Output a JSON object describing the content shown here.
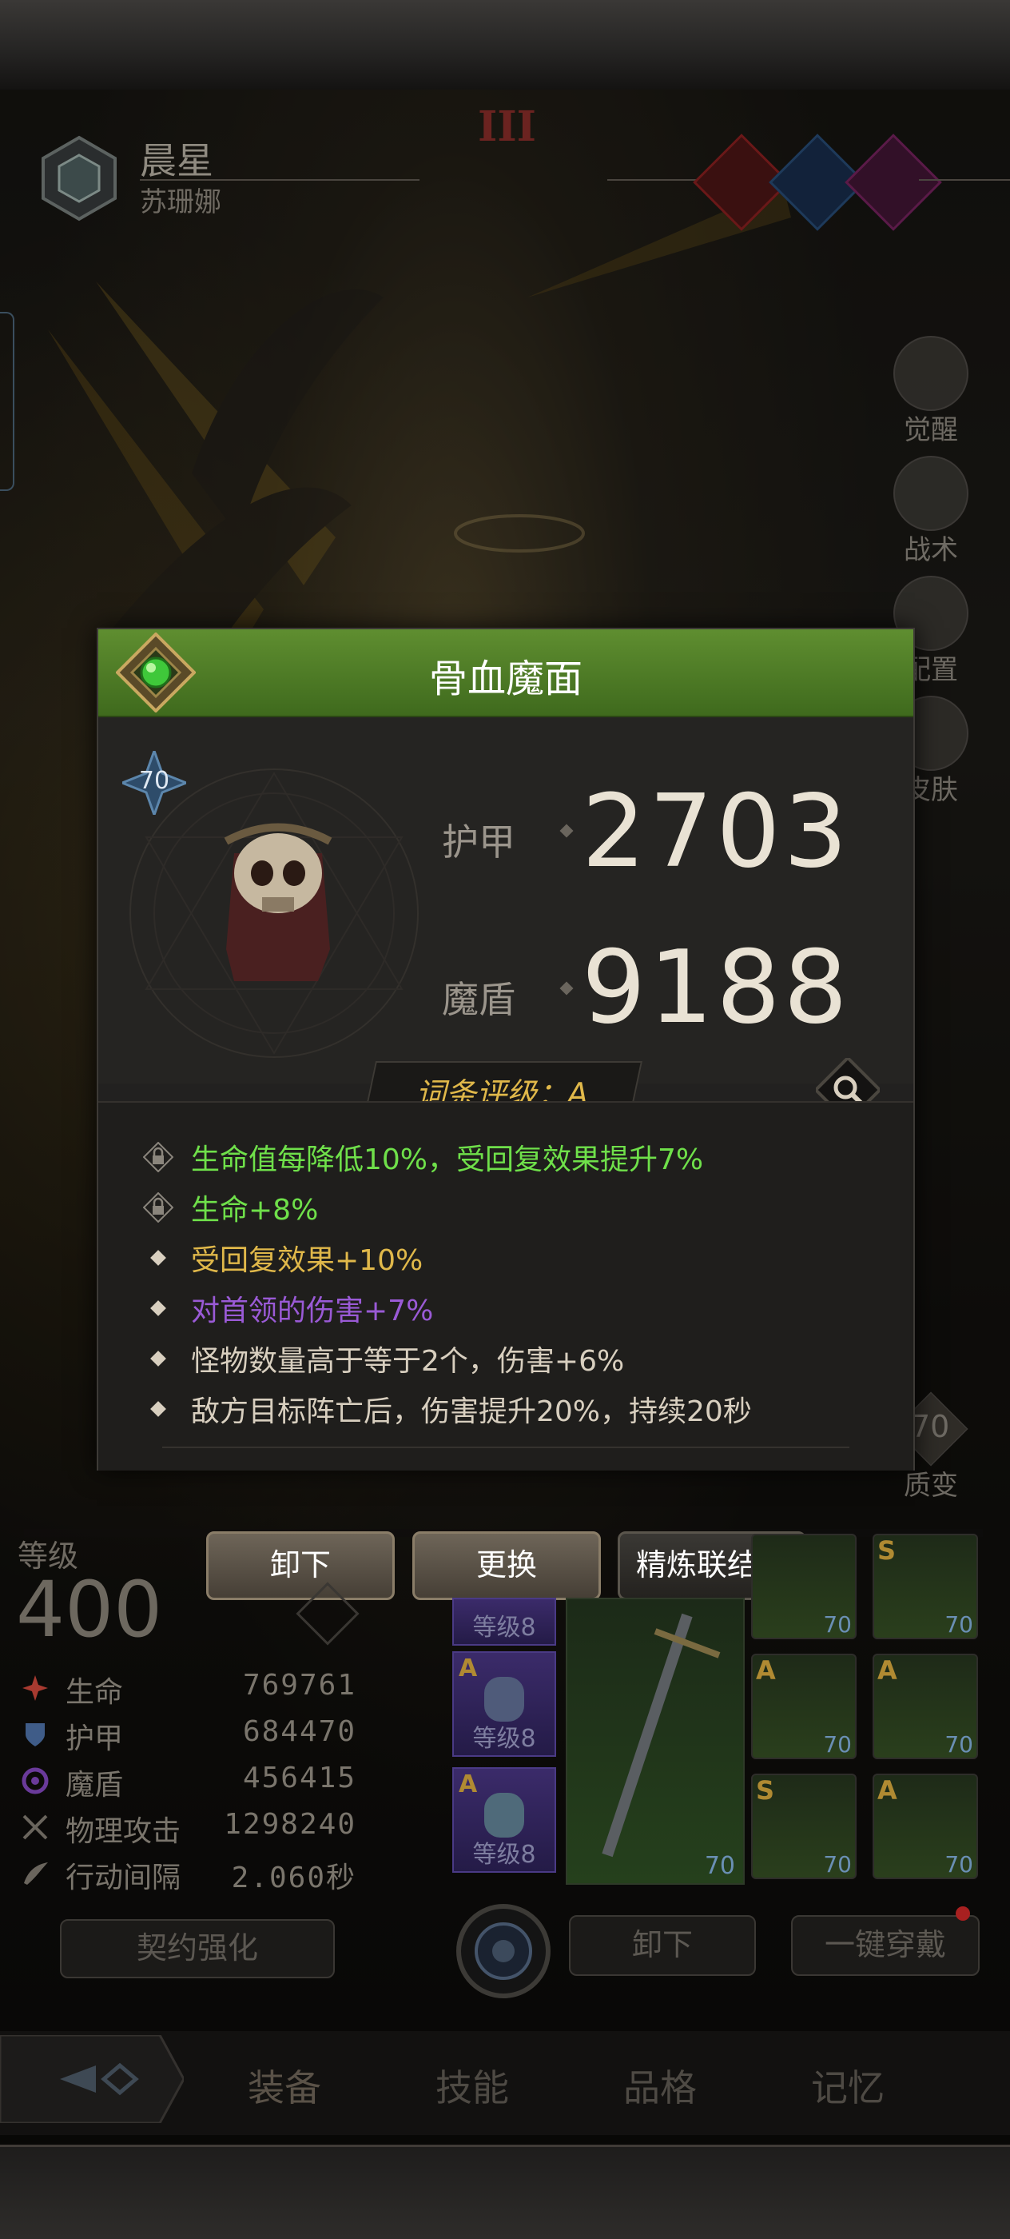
{
  "header": {
    "title": "晨星",
    "subtitle": "苏珊娜",
    "tier": "III",
    "gem_colors": [
      "#7a1f1f",
      "#1e3f63",
      "#5a1f4a"
    ]
  },
  "side_menu": [
    {
      "label": "觉醒",
      "icon": "sun-icon"
    },
    {
      "label": "战术",
      "icon": "tower-icon"
    },
    {
      "label": "配置",
      "icon": "helmet-icon"
    },
    {
      "label": "皮肤",
      "icon": "armor-icon"
    },
    {
      "label": "质变",
      "icon": "transmute-icon"
    }
  ],
  "side_menu_side_level": "70",
  "popup": {
    "title": "骨血魔面",
    "item_level": "70",
    "stats": [
      {
        "label": "护甲",
        "value": "2703"
      },
      {
        "label": "魔盾",
        "value": "9188"
      }
    ],
    "rating": "词条评级：A",
    "affixes": [
      {
        "text": "生命值每降低10%，受回复效果提升7%",
        "color": "#6fe04a",
        "locked": true
      },
      {
        "text": "生命+8%",
        "color": "#6fe04a",
        "locked": true
      },
      {
        "text": "受回复效果+10%",
        "color": "#e0b84a",
        "locked": false
      },
      {
        "text": "对首领的伤害+7%",
        "color": "#9a5ad6",
        "locked": false
      },
      {
        "text": "怪物数量高于等于2个，伤害+6%",
        "color": "#d8cfbf",
        "locked": false
      },
      {
        "text": "敌方目标阵亡后，伤害提升20%，持续20秒",
        "color": "#d8cfbf",
        "locked": false
      }
    ]
  },
  "actions": {
    "unequip": "卸下",
    "replace": "更换",
    "refine": "精炼联结中"
  },
  "character": {
    "level_label": "等级",
    "level": "400",
    "stats": [
      {
        "label": "生命",
        "value": "769761",
        "icon": "life-icon",
        "color": "#a83a30"
      },
      {
        "label": "护甲",
        "value": "684470",
        "icon": "shield-icon",
        "color": "#4a6a9a"
      },
      {
        "label": "魔盾",
        "value": "456415",
        "icon": "swirl-icon",
        "color": "#6a3a9a"
      },
      {
        "label": "物理攻击",
        "value": "1298240",
        "icon": "swords-icon",
        "color": "#7a756c"
      },
      {
        "label": "行动间隔",
        "value": "2.060秒",
        "icon": "wing-icon",
        "color": "#7a756c"
      }
    ],
    "contract_button": "契约强化"
  },
  "gems": [
    {
      "grade": "A",
      "level": "等级8"
    },
    {
      "grade": "A",
      "level": "等级8"
    },
    {
      "grade": "A",
      "level": "等级8"
    }
  ],
  "weapon_level": "70",
  "equipment_slots": [
    {
      "grade": "",
      "level": "70"
    },
    {
      "grade": "S",
      "level": "70"
    },
    {
      "grade": "A",
      "level": "70"
    },
    {
      "grade": "A",
      "level": "70"
    },
    {
      "grade": "S",
      "level": "70"
    },
    {
      "grade": "A",
      "level": "70"
    }
  ],
  "bottom_buttons": {
    "unequip_all": "卸下",
    "equip_all": "一键穿戴"
  },
  "tabs": [
    "装备",
    "技能",
    "品格",
    "记忆"
  ]
}
